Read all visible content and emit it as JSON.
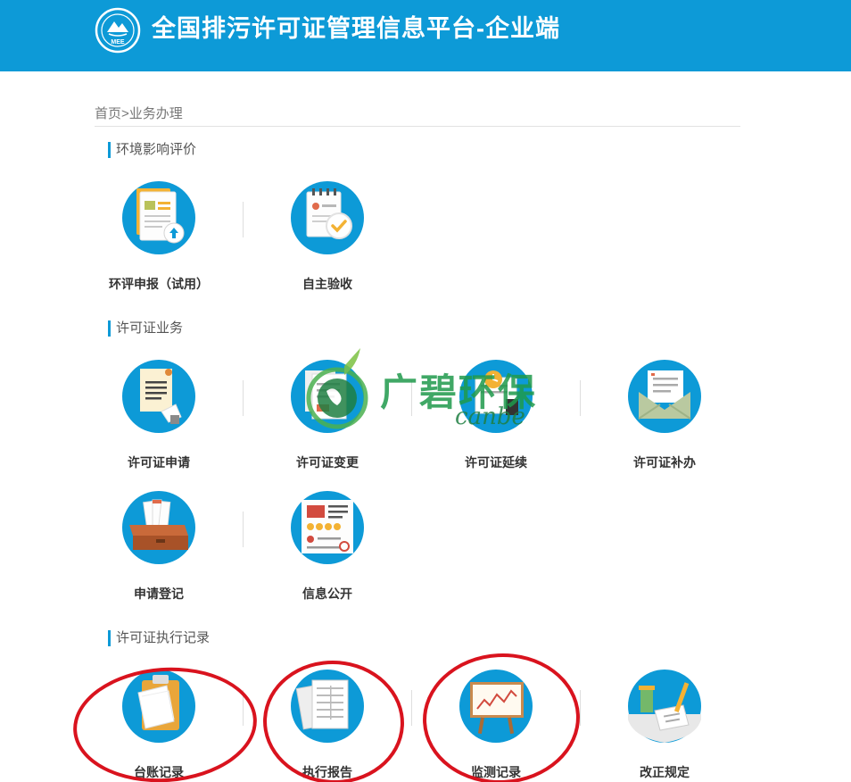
{
  "header": {
    "logo_text": "MEE",
    "title": "全国排污许可证管理信息平台-企业端"
  },
  "breadcrumb": {
    "text": "首页>业务办理"
  },
  "sections": [
    {
      "title": "环境影响评价",
      "tiles": [
        {
          "label": "环评申报（试用）"
        },
        {
          "label": "自主验收"
        }
      ]
    },
    {
      "title": "许可证业务",
      "tiles": [
        {
          "label": "许可证申请"
        },
        {
          "label": "许可证变更"
        },
        {
          "label": "许可证延续"
        },
        {
          "label": "许可证补办"
        },
        {
          "label": "申请登记"
        },
        {
          "label": "信息公开"
        }
      ]
    },
    {
      "title": "许可证执行记录",
      "tiles": [
        {
          "label": "台账记录"
        },
        {
          "label": "执行报告"
        },
        {
          "label": "监测记录"
        },
        {
          "label": "改正规定"
        }
      ]
    }
  ],
  "watermark": {
    "text": "广碧环保",
    "sub": "canbe"
  },
  "colors": {
    "header_bg": "#0d9ad7",
    "icon_bg": "#0d9ad7",
    "highlight_ring": "#d9131e"
  }
}
